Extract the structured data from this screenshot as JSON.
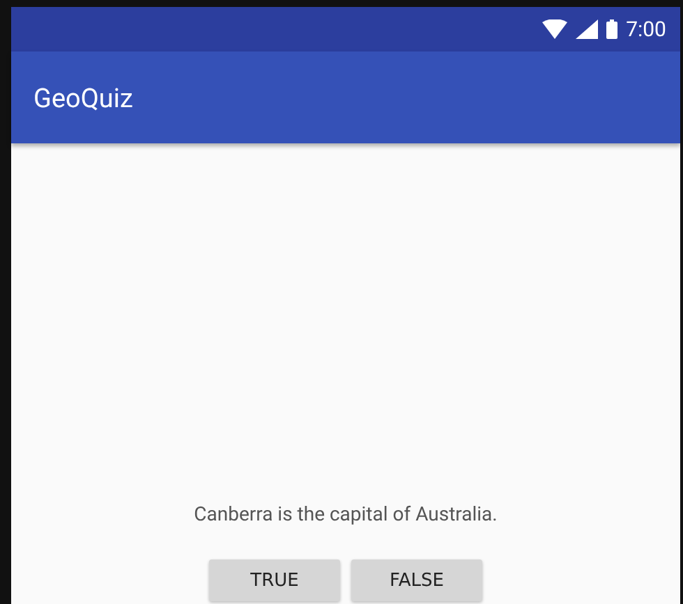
{
  "status_bar": {
    "time": "7:00"
  },
  "app_bar": {
    "title": "GeoQuiz"
  },
  "question": "Canberra is the capital of Australia.",
  "buttons": [
    {
      "label": "TRUE"
    },
    {
      "label": "FALSE"
    }
  ]
}
